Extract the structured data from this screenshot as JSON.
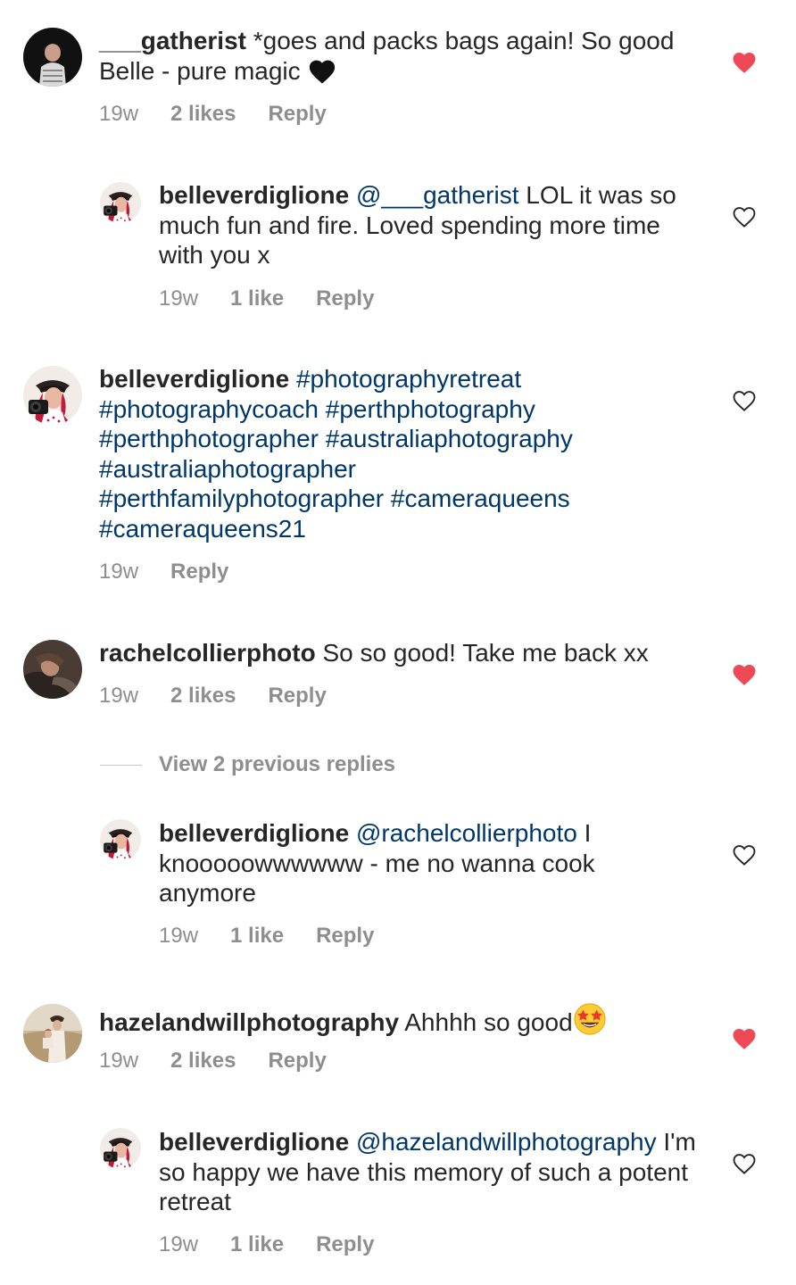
{
  "comments": [
    {
      "username": "___gatherist",
      "text": "*goes and packs bags again! So good Belle - pure magic",
      "emoji": "black-heart",
      "time": "19w",
      "likes": "2 likes",
      "reply": "Reply",
      "liked": true
    },
    {
      "username": "belleverdiglione",
      "mention": "@___gatherist",
      "text": "LOL it was so much fun and fire. Loved spending more time with you x",
      "time": "19w",
      "likes": "1 like",
      "reply": "Reply",
      "liked": false
    },
    {
      "username": "belleverdiglione",
      "hashtags": "#photographyretreat #photographycoach #perthphotography #perthphotographer #australiaphotography #australiaphotographer #perthfamilyphotographer #cameraqueens #cameraqueens21",
      "time": "19w",
      "reply": "Reply",
      "liked": false
    },
    {
      "username": "rachelcollierphoto",
      "text": "So so good! Take me back xx",
      "time": "19w",
      "likes": "2 likes",
      "reply": "Reply",
      "liked": true
    },
    {
      "username": "belleverdiglione",
      "mention": "@rachelcollierphoto",
      "text": "I knooooowwwwww - me no wanna cook anymore",
      "time": "19w",
      "likes": "1 like",
      "reply": "Reply",
      "liked": false
    },
    {
      "username": "hazelandwillphotography",
      "text": "Ahhhh so good",
      "emoji": "star-struck",
      "time": "19w",
      "likes": "2 likes",
      "reply": "Reply",
      "liked": true
    },
    {
      "username": "belleverdiglione",
      "mention": "@hazelandwillphotography",
      "text": "I'm so happy we have this memory of such a potent retreat",
      "time": "19w",
      "likes": "1 like",
      "reply": "Reply",
      "liked": false
    }
  ],
  "view_replies": "View 2 previous replies",
  "colors": {
    "text": "#262626",
    "secondary": "#8e8e8e",
    "link": "#00376b",
    "like_red": "#ed4956"
  },
  "icons": {
    "liked": "heart-filled-icon",
    "unliked": "heart-outline-icon"
  }
}
